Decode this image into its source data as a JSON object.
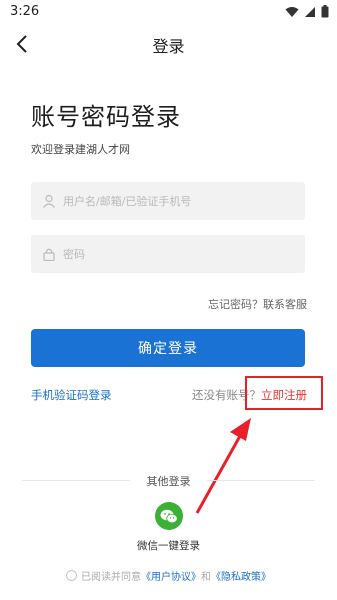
{
  "status_bar": {
    "time": "3:26"
  },
  "nav": {
    "title": "登录"
  },
  "main": {
    "heading": "账号密码登录",
    "subheading": "欢迎登录建湖人才网",
    "username_placeholder": "用户名/邮箱/已验证手机号",
    "password_placeholder": "密码",
    "forgot_label": "忘记密码？",
    "contact_label": "联系客服",
    "login_button": "确定登录",
    "sms_login": "手机验证码登录",
    "no_account_label": "还没有账号？",
    "register_link": "立即注册"
  },
  "other_login": {
    "label": "其他登录",
    "wechat_label": "微信一键登录"
  },
  "agreement": {
    "prefix": "已阅读并同意",
    "user_agreement": "《用户协议》",
    "and": "和",
    "privacy_policy": "《隐私政策》"
  },
  "colors": {
    "primary": "#1a73d4",
    "register": "#e53935",
    "annotation": "#e8202a",
    "wechat": "#3cb034"
  }
}
